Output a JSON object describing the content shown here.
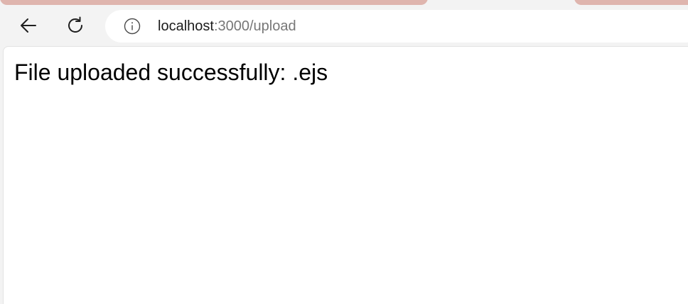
{
  "browser": {
    "address_bar": {
      "host": "localhost",
      "path": ":3000/upload"
    }
  },
  "page": {
    "message": "File uploaded successfully: .ejs"
  },
  "colors": {
    "tab_accent": "#dfb5ae",
    "chrome_background": "#f3f3f3",
    "page_background": "#ffffff",
    "url_host": "#1b1b1b",
    "url_path": "#777777"
  },
  "icons": {
    "back": "back-arrow-icon",
    "reload": "reload-icon",
    "site_info": "info-icon"
  }
}
